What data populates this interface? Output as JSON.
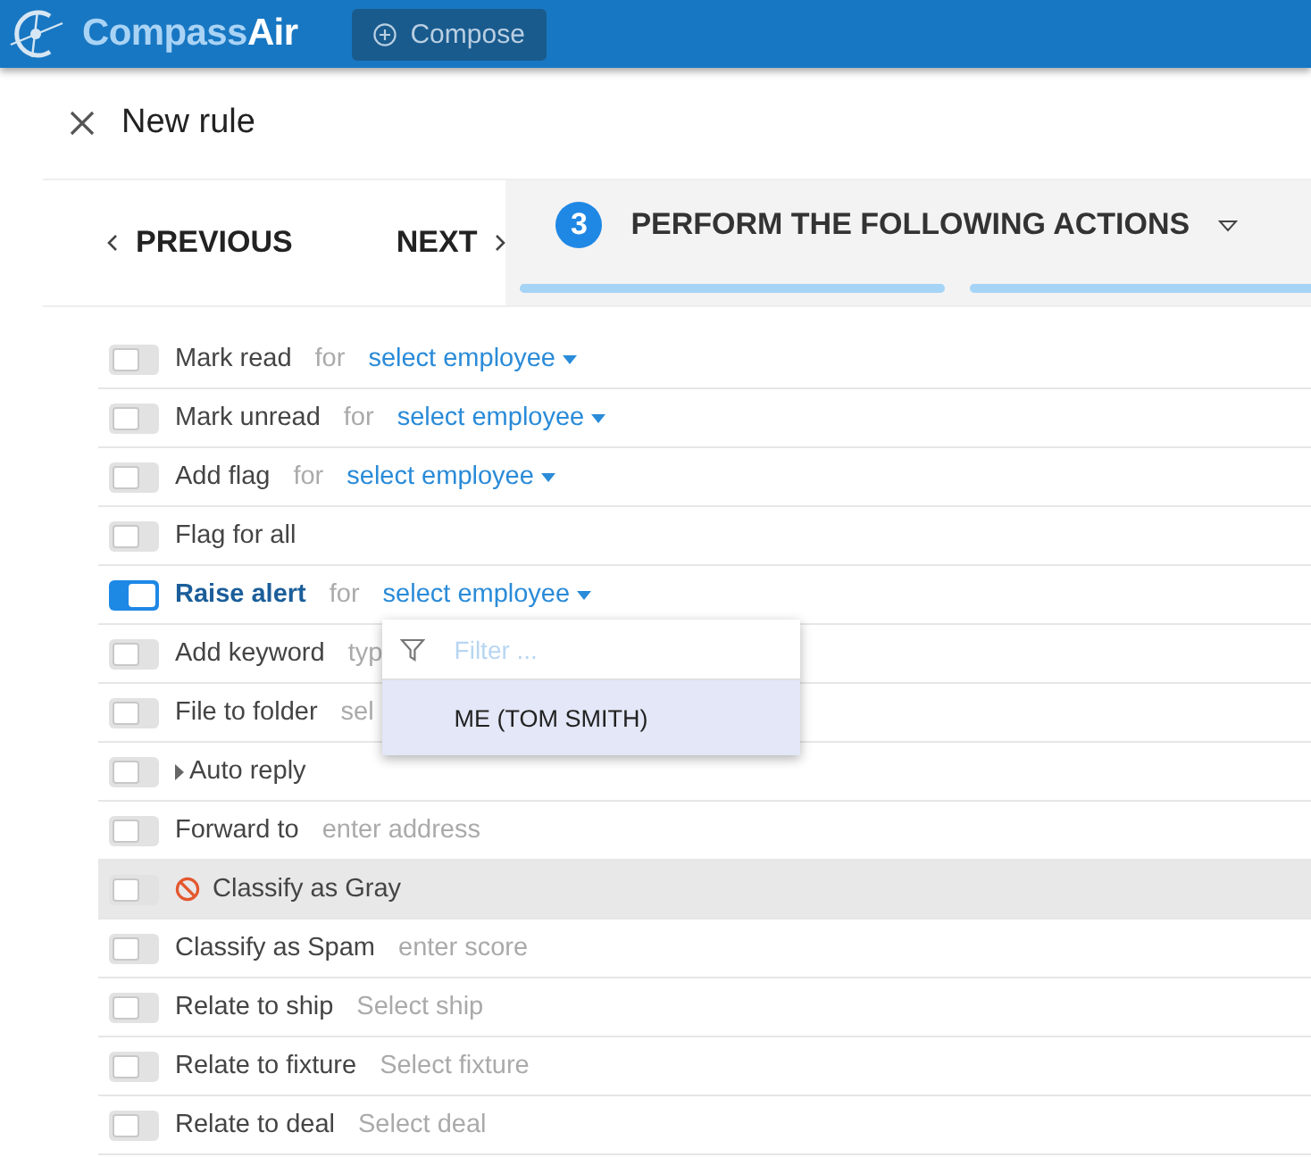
{
  "header": {
    "logo_text": "Compass**Air**",
    "compose_label": "Compose"
  },
  "title": "New rule",
  "nav": {
    "previous": "PREVIOUS",
    "next": "NEXT"
  },
  "step": {
    "number": "3",
    "title": "PERFORM THE FOLLOWING ACTIONS",
    "progress": [
      {
        "level": 1
      },
      {
        "level": 1
      }
    ]
  },
  "rows": [
    {
      "label": "Mark read",
      "on": false,
      "highlighted": false,
      "connector": "for",
      "select": "select employee"
    },
    {
      "label": "Mark unread",
      "on": false,
      "highlighted": false,
      "connector": "for",
      "select": "select employee"
    },
    {
      "label": "Add flag",
      "on": false,
      "highlighted": false,
      "connector": "for",
      "select": "select employee"
    },
    {
      "label": "Flag for all",
      "on": false,
      "highlighted": false
    },
    {
      "label": "Raise alert",
      "on": true,
      "highlighted": false,
      "connector": "for",
      "select": "select employee",
      "dropdown": {
        "placeholder": "Filter ...",
        "options": [
          {
            "label": "ME (TOM SMITH)",
            "selected": true
          }
        ]
      }
    },
    {
      "label": "Add keyword",
      "on": false,
      "highlighted": false,
      "placeholder": "typ"
    },
    {
      "label": "File to folder",
      "on": false,
      "highlighted": false,
      "placeholder": "sel"
    },
    {
      "label": "Auto reply",
      "on": false,
      "highlighted": false,
      "kind": "expander"
    },
    {
      "label": "Forward to",
      "on": false,
      "highlighted": false,
      "placeholder": "enter address"
    },
    {
      "label": "Classify as Gray",
      "on": false,
      "highlighted": true,
      "kind": "blocked"
    },
    {
      "label": "Classify as Spam",
      "on": false,
      "highlighted": false,
      "placeholder": "enter score"
    },
    {
      "label": "Relate to ship",
      "on": false,
      "highlighted": false,
      "placeholder": "Select ship"
    },
    {
      "label": "Relate to fixture",
      "on": false,
      "highlighted": false,
      "placeholder": "Select fixture"
    },
    {
      "label": "Relate to deal",
      "on": false,
      "highlighted": false,
      "placeholder": "Select deal"
    }
  ]
}
